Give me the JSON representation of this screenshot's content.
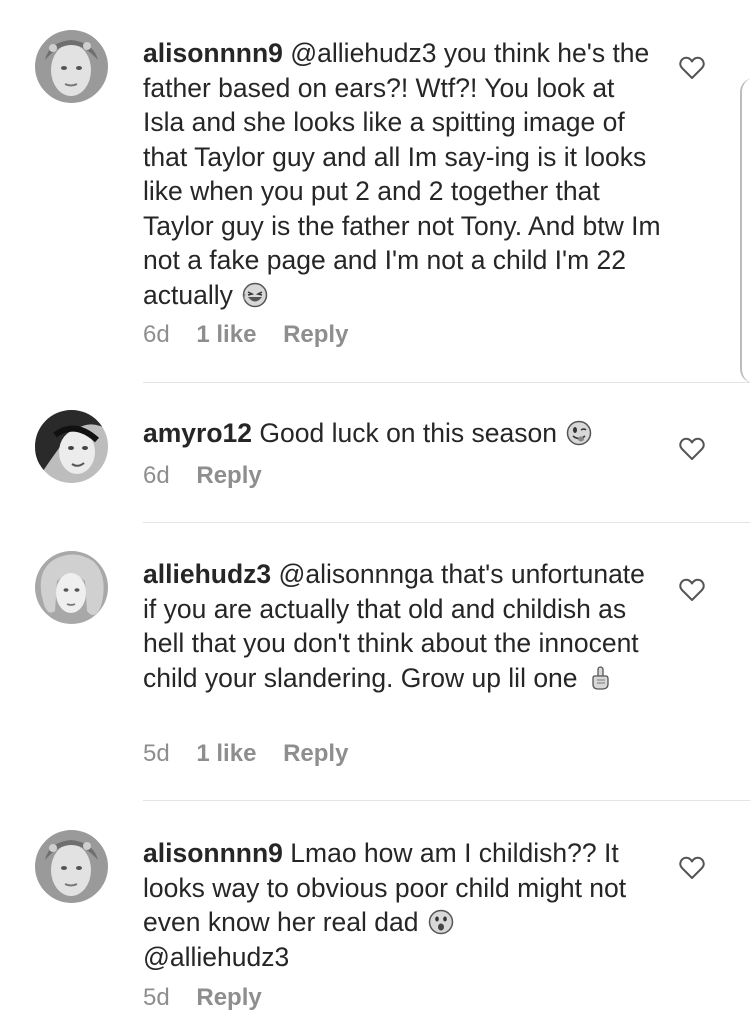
{
  "comments": [
    {
      "username": "alisonnnn9",
      "text": "@alliehudz3 you think he's the father based on ears?! Wtf?! You look at Isla and she looks like a spitting image of that Taylor guy and all Im say-ing is it looks like when you put 2 and 2 together that Taylor guy is the father not Tony. And btw Im not a fake page and I'm not a child I'm 22 actually",
      "emoji": "😂",
      "time": "6d",
      "likes": "1 like",
      "reply": "Reply"
    },
    {
      "username": "amyro12",
      "text": "Good luck on this season",
      "emoji": "😜",
      "time": "6d",
      "likes": "",
      "reply": "Reply"
    },
    {
      "username": "alliehudz3",
      "text": "@alisonnnga that's unfortunate if you are actually that old and childish as hell that you don't think about the innocent child your slandering. Grow up lil one",
      "emoji": "☝",
      "time": "5d",
      "likes": "1 like",
      "reply": "Reply"
    },
    {
      "username": "alisonnnn9",
      "text": "Lmao how am I childish?? It looks way to obvious poor child might not even know her real dad",
      "emoji": "😯",
      "text_after": "@alliehudz3",
      "time": "5d",
      "likes": "",
      "reply": "Reply"
    }
  ],
  "icons": {
    "like": "heart-outline-icon",
    "avatar": "profile-photo"
  },
  "colors": {
    "text": "#262626",
    "meta": "#8e8e8e",
    "divider": "#e4e4e4"
  }
}
